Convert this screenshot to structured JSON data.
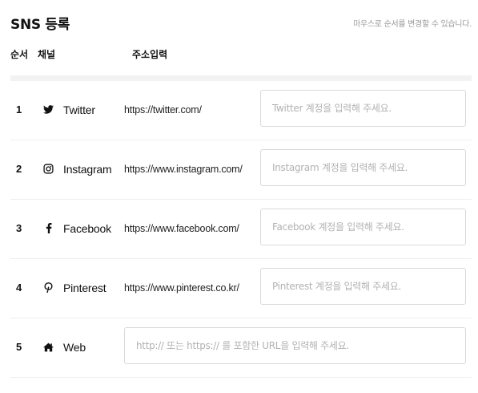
{
  "header": {
    "title": "SNS 등록",
    "hint": "마우스로 순서를 변경할 수 있습니다."
  },
  "columns": {
    "order": "순서",
    "channel": "채널",
    "url": "주소입력"
  },
  "rows": [
    {
      "order": "1",
      "icon": "twitter-icon",
      "name": "Twitter",
      "base_url": "https://twitter.com/",
      "value": "",
      "placeholder": "Twitter 계정을 입력해 주세요."
    },
    {
      "order": "2",
      "icon": "instagram-icon",
      "name": "Instagram",
      "base_url": "https://www.instagram.com/",
      "value": "",
      "placeholder": "Instagram 계정을 입력해 주세요."
    },
    {
      "order": "3",
      "icon": "facebook-icon",
      "name": "Facebook",
      "base_url": "https://www.facebook.com/",
      "value": "",
      "placeholder": "Facebook 계정을 입력해 주세요."
    },
    {
      "order": "4",
      "icon": "pinterest-icon",
      "name": "Pinterest",
      "base_url": "https://www.pinterest.co.kr/",
      "value": "",
      "placeholder": "Pinterest 계정을 입력해 주세요."
    },
    {
      "order": "5",
      "icon": "home-icon",
      "name": "Web",
      "value": "",
      "placeholder": "http:// 또는 https:// 를 포함한 URL을 입력해 주세요."
    }
  ],
  "colors": {
    "text": "#111111",
    "hint": "#9a9a9a",
    "placeholder": "#b2b2b2",
    "border": "#d9d9d9",
    "divider": "#f2f2f2"
  }
}
